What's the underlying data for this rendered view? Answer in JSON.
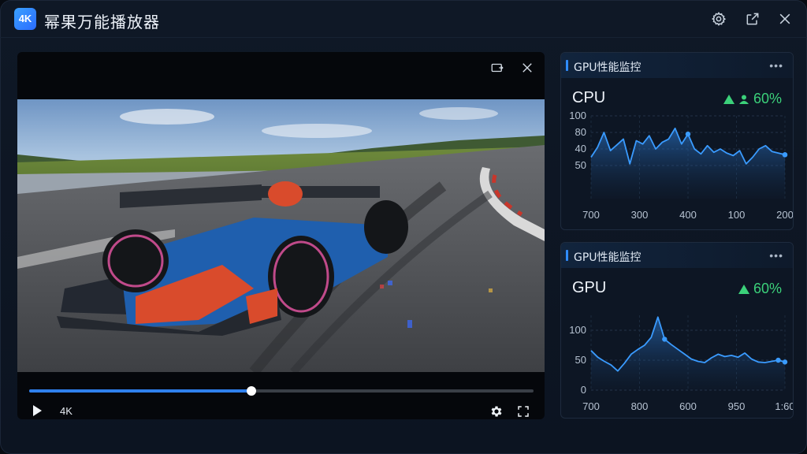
{
  "app": {
    "logo_text": "4K",
    "title": "幂果万能播放器"
  },
  "player": {
    "quality_label": "4K",
    "progress": 0.44
  },
  "monitors": [
    {
      "header": "GPU性能监控",
      "more": "•••",
      "metric": "CPU",
      "value": "60%",
      "trend": "up",
      "y_ticks": [
        "100",
        "80",
        "40",
        "50"
      ],
      "x_ticks": [
        "700",
        "300",
        "400",
        "100",
        "200"
      ]
    },
    {
      "header": "GPU性能监控",
      "more": "•••",
      "metric": "GPU",
      "value": "60%",
      "trend": "up",
      "y_ticks": [
        "100",
        "50",
        "0"
      ],
      "x_ticks": [
        "700",
        "800",
        "600",
        "950",
        "1:60"
      ]
    }
  ],
  "colors": {
    "accent": "#2f80ed",
    "positive": "#3bd17a",
    "chart_line": "#3a9bff"
  },
  "icons": [
    "settings-icon",
    "share-icon",
    "close-icon",
    "cast-icon",
    "play-icon",
    "fullscreen-icon"
  ],
  "chart_data": [
    {
      "type": "area",
      "title": "CPU",
      "series": [
        {
          "values": [
            50,
            62,
            80,
            58,
            65,
            72,
            42,
            70,
            66,
            76,
            60,
            68,
            72,
            85,
            66,
            78,
            60,
            54,
            64,
            56,
            60,
            55,
            52,
            58,
            42,
            50,
            60,
            64,
            57,
            55,
            53
          ]
        }
      ],
      "y_tick_labels": [
        "100",
        "80",
        "40",
        "50"
      ],
      "x_tick_labels": [
        "700",
        "300",
        "400",
        "100",
        "200"
      ],
      "ylim": [
        0,
        100
      ],
      "grid": true
    },
    {
      "type": "area",
      "title": "GPU",
      "series": [
        {
          "values": [
            66,
            55,
            48,
            42,
            32,
            45,
            60,
            68,
            75,
            88,
            122,
            85,
            76,
            68,
            60,
            52,
            48,
            46,
            54,
            60,
            56,
            58,
            55,
            62,
            52,
            47,
            46,
            48,
            50,
            47
          ]
        }
      ],
      "y_tick_labels": [
        "100",
        "50",
        "0"
      ],
      "x_tick_labels": [
        "700",
        "800",
        "600",
        "950",
        "1:60"
      ],
      "ylim": [
        0,
        125
      ],
      "grid": true
    }
  ]
}
